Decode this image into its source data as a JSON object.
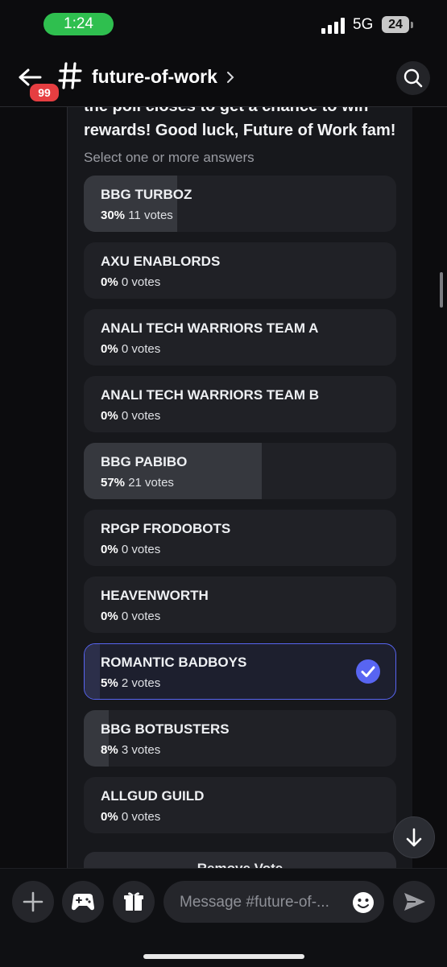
{
  "status_bar": {
    "time": "1:24",
    "network": "5G",
    "battery": "24"
  },
  "header": {
    "unread_badge": "99",
    "channel_name": "future-of-work"
  },
  "poll": {
    "text_partial": "the poll closes to get a chance to win rewards! Good luck, Future of Work fam!",
    "hint": "Select one or more answers",
    "answers": [
      {
        "label": "BBG TURBOZ",
        "percent": "30%",
        "votes": "11 votes",
        "fill_fraction": 0.3,
        "selected": false
      },
      {
        "label": "AXU ENABLORDS",
        "percent": "0%",
        "votes": "0 votes",
        "fill_fraction": 0,
        "selected": false
      },
      {
        "label": "ANALI TECH WARRIORS TEAM A",
        "percent": "0%",
        "votes": "0 votes",
        "fill_fraction": 0,
        "selected": false
      },
      {
        "label": "ANALI TECH WARRIORS TEAM B",
        "percent": "0%",
        "votes": "0 votes",
        "fill_fraction": 0,
        "selected": false
      },
      {
        "label": "BBG PABIBO",
        "percent": "57%",
        "votes": "21 votes",
        "fill_fraction": 0.57,
        "selected": false
      },
      {
        "label": "RPGP FRODOBOTS",
        "percent": "0%",
        "votes": "0 votes",
        "fill_fraction": 0,
        "selected": false
      },
      {
        "label": "HEAVENWORTH",
        "percent": "0%",
        "votes": "0 votes",
        "fill_fraction": 0,
        "selected": false
      },
      {
        "label": "ROMANTIC BADBOYS",
        "percent": "5%",
        "votes": "2 votes",
        "fill_fraction": 0.05,
        "selected": true
      },
      {
        "label": "BBG BOTBUSTERS",
        "percent": "8%",
        "votes": "3 votes",
        "fill_fraction": 0.08,
        "selected": false
      },
      {
        "label": "ALLGUD GUILD",
        "percent": "0%",
        "votes": "0 votes",
        "fill_fraction": 0,
        "selected": false
      }
    ],
    "remove_vote_label": "Remove Vote"
  },
  "composer": {
    "placeholder": "Message #future-of-..."
  },
  "colors": {
    "accent": "#5865f2",
    "badge": "#e63e41",
    "time_pill": "#2fbf4f"
  }
}
